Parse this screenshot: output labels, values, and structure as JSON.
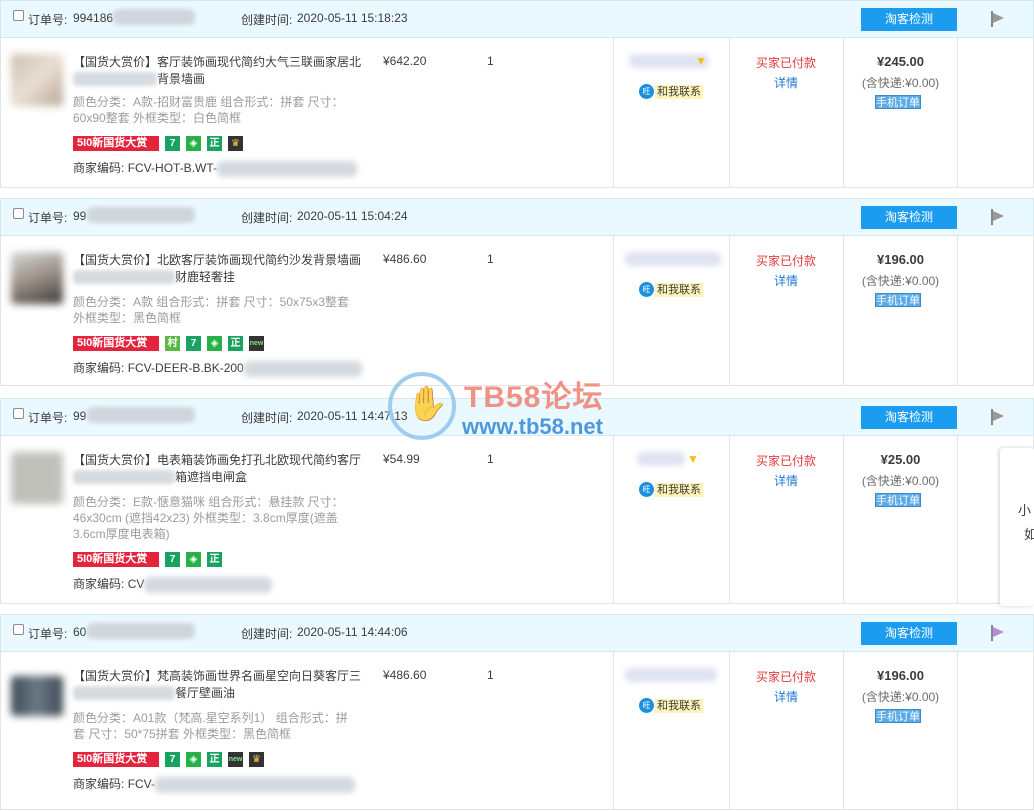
{
  "labels": {
    "order_no": "订单号:",
    "created": "创建时间:",
    "check_btn": "淘客检测",
    "merchant_code": "商家编码:",
    "contact": "和我联系",
    "status": "买家已付款",
    "detail": "详情",
    "mobile_order": "手机订单",
    "tag_510": "5I0新国货大赏",
    "tag_sq7": "7",
    "tag_zheng": "正",
    "tag_cun": "村",
    "tag_new": "new"
  },
  "colors": {
    "header_bg": "#eaf8ff",
    "button_blue": "#1c9cee",
    "status_red": "#e4393c",
    "link_blue": "#2278d3"
  },
  "orders": [
    {
      "order_no_prefix": "994186",
      "created_time": "2020-05-11 15:18:23",
      "title_prefix": "【国货大赏价】客厅装饰画现代简约大气三联画家居北",
      "title_suffix": "背景墙画",
      "attr_line1": "颜色分类：A款-招财富贵鹿  组合形式：拼套  尺寸：",
      "attr_line2": "60x90整套  外框类型：白色简框",
      "code_prefix": "FCV-HOT-B.WT-",
      "price": "¥642.20",
      "qty": "1",
      "total": "¥245.00",
      "shipping": "(含快递:¥0.00)"
    },
    {
      "order_no_prefix": "99",
      "created_time": "2020-05-11 15:04:24",
      "title_prefix": "【国货大赏价】北欧客厅装饰画现代简约沙发背景墙画",
      "title_suffix": "财鹿轻奢挂",
      "attr_line1": "颜色分类：A款  组合形式：拼套  尺寸：50x75x3整套",
      "attr_line2": "外框类型：黑色简框",
      "code_prefix": "FCV-DEER-B.BK-200",
      "price": "¥486.60",
      "qty": "1",
      "total": "¥196.00",
      "shipping": "(含快递:¥0.00)"
    },
    {
      "order_no_prefix": "99",
      "created_time": "2020-05-11 14:47:13",
      "title_prefix": "【国货大赏价】电表箱装饰画免打孔北欧现代简约客厅",
      "title_suffix": "箱遮挡电闸盒",
      "attr_line1": "颜色分类：E款-惬意猫咪  组合形式：悬挂款  尺寸：",
      "attr_line2": "46x30cm (遮挡42x23)  外框类型：3.8cm厚度(遮盖",
      "attr_line3": "3.6cm厚度电表箱)",
      "code_prefix": "CV",
      "price": "¥54.99",
      "qty": "1",
      "total": "¥25.00",
      "shipping": "(含快递:¥0.00)"
    },
    {
      "order_no_prefix": "60",
      "created_time": "2020-05-11 14:44:06",
      "title_prefix": "【国货大赏价】梵高装饰画世界名画星空向日葵客厅三",
      "title_suffix": "餐厅壁画油",
      "attr_line1": "颜色分类：A01款（梵高.星空系列1）  组合形式：拼",
      "attr_line2": "套  尺寸：50*75拼套  外框类型：黑色简框",
      "code_prefix": "FCV-",
      "price": "¥486.60",
      "qty": "1",
      "total": "¥196.00",
      "shipping": "(含快递:¥0.00)"
    }
  ],
  "watermark": {
    "title": "TB58论坛",
    "url": "www.tb58.net"
  },
  "popup": {
    "line1": "小",
    "line2": "如"
  }
}
